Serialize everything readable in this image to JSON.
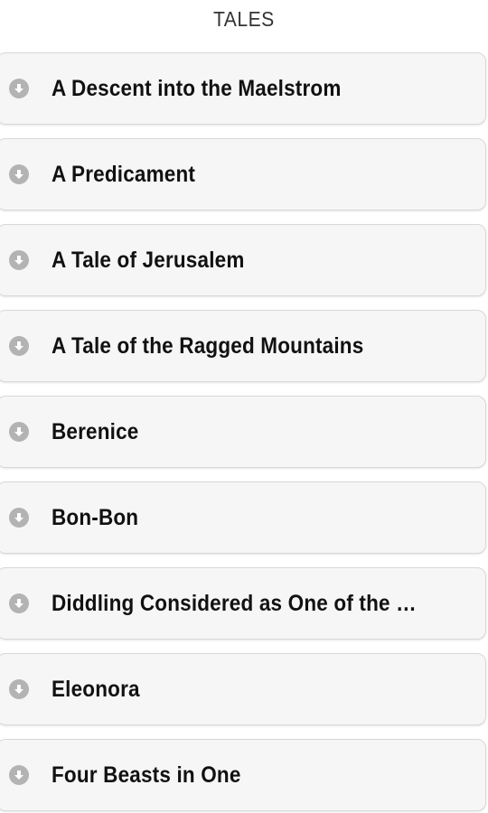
{
  "header": {
    "title": "TALES"
  },
  "list": {
    "items": [
      {
        "label": "A Descent into the Maelstrom",
        "icon": "download-icon"
      },
      {
        "label": "A Predicament",
        "icon": "download-icon"
      },
      {
        "label": "A Tale of Jerusalem",
        "icon": "download-icon"
      },
      {
        "label": "A Tale of the Ragged Mountains",
        "icon": "download-icon"
      },
      {
        "label": "Berenice",
        "icon": "download-icon"
      },
      {
        "label": "Bon-Bon",
        "icon": "download-icon"
      },
      {
        "label": "Diddling Considered as One of the Ex...",
        "icon": "download-icon"
      },
      {
        "label": "Eleonora",
        "icon": "download-icon"
      },
      {
        "label": "Four Beasts in One",
        "icon": "download-icon"
      }
    ]
  },
  "colors": {
    "background": "#ffffff",
    "item_background": "#f6f6f6",
    "item_border": "#d8d8d8",
    "icon_background": "#b3b3b3",
    "text": "#111111"
  }
}
